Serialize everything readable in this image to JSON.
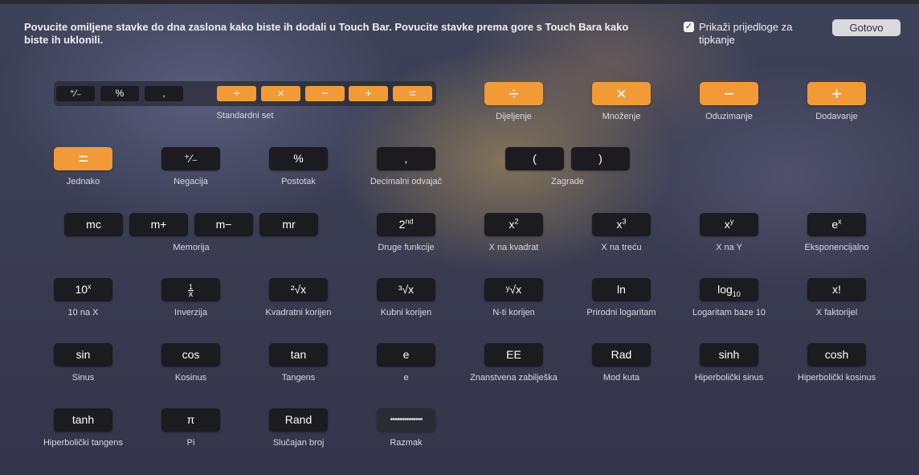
{
  "instructions": "Povucite omiljene stavke do dna zaslona kako biste ih dodali u Touch Bar. Povucite stavke prema gore s Touch Bara kako biste ih uklonili.",
  "suggestions": {
    "checked": "✓",
    "label": "Prikaži prijedloge za tipkanje"
  },
  "done_label": "Gotovo",
  "standard_set": {
    "caption": "Standardni set",
    "keys": [
      "⁺⁄₋",
      "%",
      ",",
      "÷",
      "×",
      "−",
      "+",
      "="
    ]
  },
  "row1": [
    {
      "key": "÷",
      "label": "Dijeljenje"
    },
    {
      "key": "×",
      "label": "Množenje"
    },
    {
      "key": "−",
      "label": "Oduzimanje"
    },
    {
      "key": "+",
      "label": "Dodavanje"
    }
  ],
  "row2": {
    "equals": {
      "key": "=",
      "label": "Jednako"
    },
    "negation": {
      "key": "⁺⁄₋",
      "label": "Negacija"
    },
    "percent": {
      "key": "%",
      "label": "Postotak"
    },
    "decimal": {
      "key": ",",
      "label": "Decimalni odvajač"
    },
    "parentheses": {
      "open": "(",
      "close": ")",
      "label": "Zagrade"
    }
  },
  "row3": {
    "memory": {
      "keys": [
        "mc",
        "m+",
        "m−",
        "mr"
      ],
      "label": "Memorija"
    },
    "second": {
      "key": "2",
      "sup": "nd",
      "label": "Druge funkcije"
    },
    "square": {
      "key": "x",
      "sup": "2",
      "label": "X na kvadrat"
    },
    "cube": {
      "key": "x",
      "sup": "3",
      "label": "X na treću"
    },
    "power": {
      "key": "x",
      "sup": "y",
      "label": "X na Y"
    },
    "exp": {
      "key": "e",
      "sup": "x",
      "label": "Eksponencijalno"
    }
  },
  "row4": {
    "ten_x": {
      "key": "10",
      "sup": "x",
      "label": "10 na X"
    },
    "inverse": {
      "num": "1",
      "den": "x",
      "label": "Inverzija"
    },
    "sqrt": {
      "key": "²√x",
      "label": "Kvadratni korijen"
    },
    "cbrt": {
      "key": "³√x",
      "label": "Kubni korijen"
    },
    "nroot": {
      "key": "ʸ√x",
      "label": "N-ti korijen"
    },
    "ln": {
      "key": "ln",
      "label": "Prirodni logaritam"
    },
    "log10": {
      "key": "log",
      "sub": "10",
      "label": "Logaritam baze 10"
    },
    "factorial": {
      "key": "x!",
      "label": "X faktorijel"
    }
  },
  "row5": [
    {
      "key": "sin",
      "label": "Sinus"
    },
    {
      "key": "cos",
      "label": "Kosinus"
    },
    {
      "key": "tan",
      "label": "Tangens"
    },
    {
      "key": "e",
      "label": "e"
    },
    {
      "key": "EE",
      "label": "Znanstvena zabilješka"
    },
    {
      "key": "Rad",
      "label": "Mod kuta"
    },
    {
      "key": "sinh",
      "label": "Hiperbolički sinus"
    },
    {
      "key": "cosh",
      "label": "Hiperbolički kosinus"
    }
  ],
  "row6": [
    {
      "key": "tanh",
      "label": "Hiperbolički tangens"
    },
    {
      "key": "π",
      "label": "Pi"
    },
    {
      "key": "Rand",
      "label": "Slučajan broj"
    },
    {
      "key": "••••••••••••••",
      "label": "Razmak"
    }
  ],
  "colors": {
    "orange": "#f29a35",
    "key_dark": "#1b1b20"
  }
}
